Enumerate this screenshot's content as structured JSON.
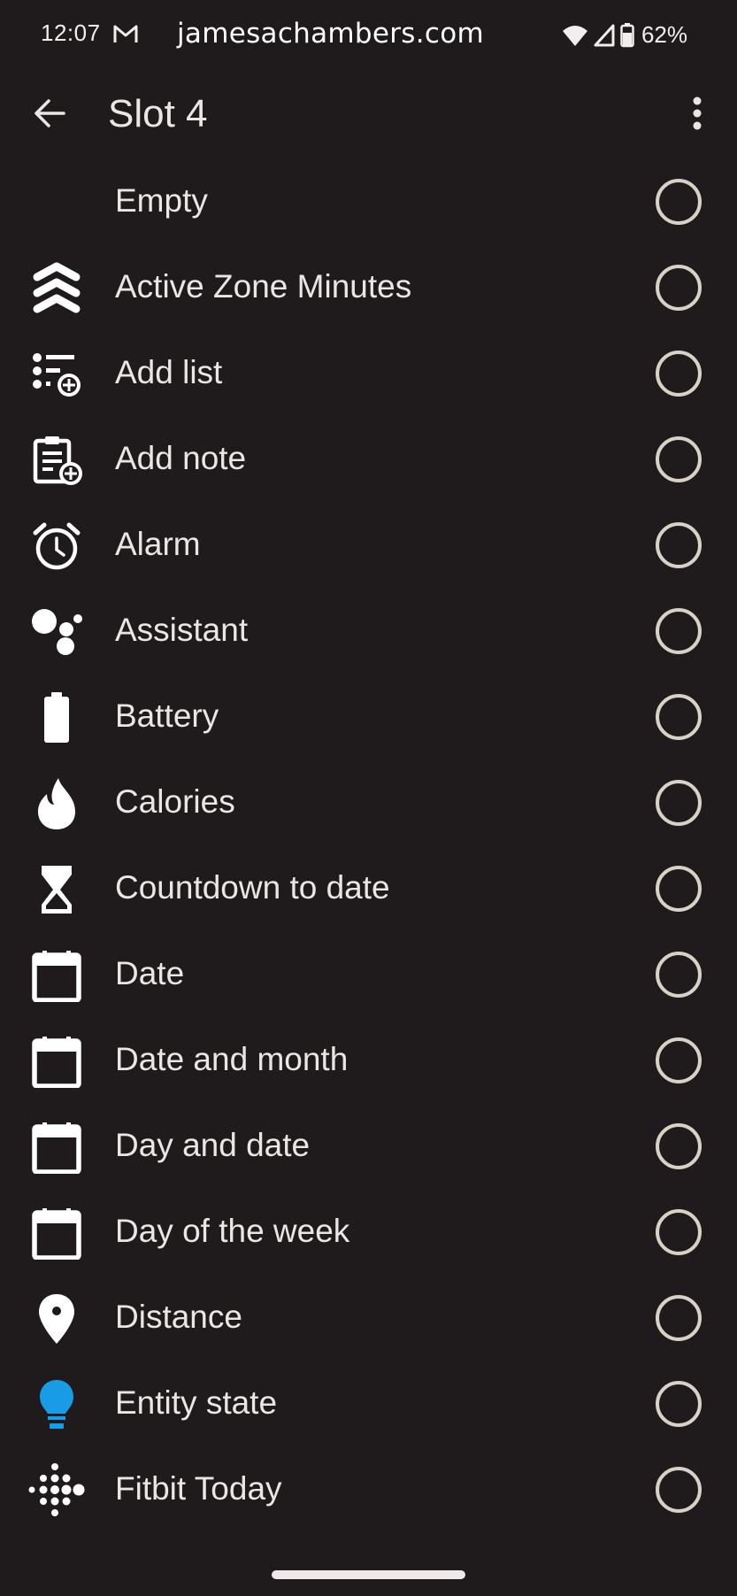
{
  "status_bar": {
    "time": "12:07",
    "notification_icon": "gmail-icon",
    "watermark": "jamesachambers.com",
    "wifi_icon": "wifi-icon",
    "signal_icon": "cell-signal-icon",
    "battery_icon": "battery-icon",
    "battery_percent": "62%"
  },
  "app_bar": {
    "back_icon": "arrow-back-icon",
    "title": "Slot 4",
    "overflow_icon": "more-vert-icon"
  },
  "options": [
    {
      "label": "Empty",
      "icon": "none",
      "selected": false
    },
    {
      "label": "Active Zone Minutes",
      "icon": "active-zone-chevrons-icon",
      "selected": false
    },
    {
      "label": "Add list",
      "icon": "add-list-icon",
      "selected": false
    },
    {
      "label": "Add note",
      "icon": "add-note-clipboard-icon",
      "selected": false
    },
    {
      "label": "Alarm",
      "icon": "alarm-clock-icon",
      "selected": false
    },
    {
      "label": "Assistant",
      "icon": "assistant-dots-icon",
      "selected": false
    },
    {
      "label": "Battery",
      "icon": "battery-icon",
      "selected": false
    },
    {
      "label": "Calories",
      "icon": "flame-icon",
      "selected": false
    },
    {
      "label": "Countdown to date",
      "icon": "hourglass-icon",
      "selected": false
    },
    {
      "label": "Date",
      "icon": "calendar-icon",
      "selected": false
    },
    {
      "label": "Date and month",
      "icon": "calendar-icon",
      "selected": false
    },
    {
      "label": "Day and date",
      "icon": "calendar-icon",
      "selected": false
    },
    {
      "label": "Day of the week",
      "icon": "calendar-icon",
      "selected": false
    },
    {
      "label": "Distance",
      "icon": "location-pin-icon",
      "selected": false
    },
    {
      "label": "Entity state",
      "icon": "lightbulb-icon",
      "selected": false
    },
    {
      "label": "Fitbit Today",
      "icon": "fitbit-logo-icon",
      "selected": false
    }
  ],
  "colors": {
    "background": "#1f1b1c",
    "text": "#ebe6e3",
    "radio_outline": "#d7d1c7",
    "entity_bulb": "#1a9be6"
  }
}
